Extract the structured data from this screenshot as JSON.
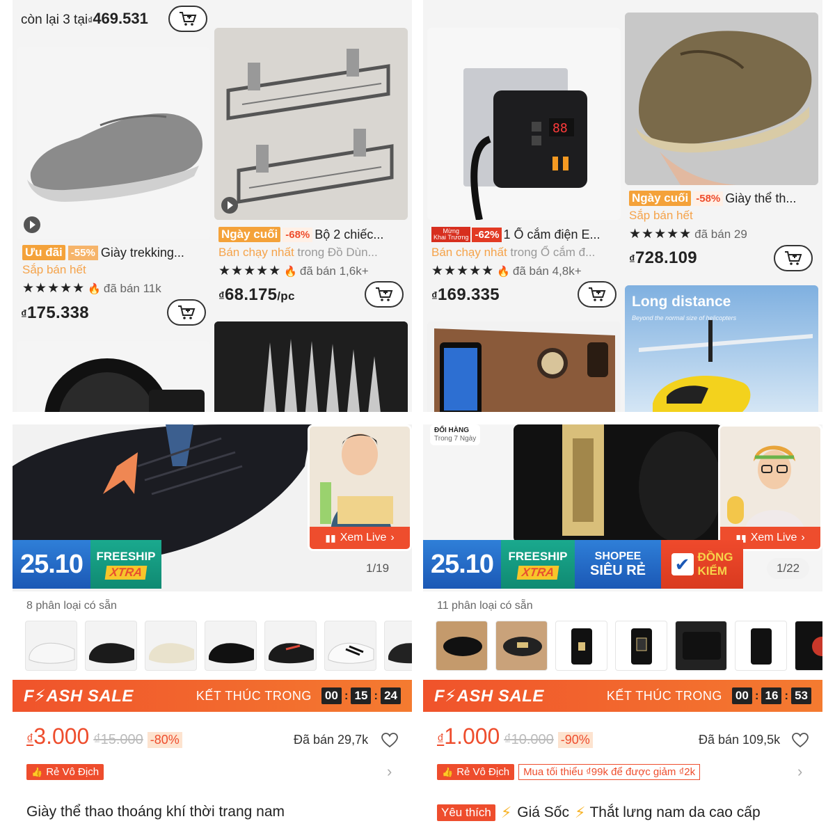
{
  "left_grid": {
    "stock_line": {
      "text": "còn lại 3 tại",
      "cur": "₫",
      "price": "469.531"
    },
    "p1": {
      "tag": "Ưu đãi",
      "pct": "-55%",
      "name": "Giày trekking...",
      "sub": "Sắp bán hết",
      "stars": "★★★★★",
      "sold": "đã bán 11k",
      "cur": "₫",
      "price": "175.338"
    },
    "p2": {
      "tag": "Ngày cuối",
      "pct": "-68%",
      "name": "Bộ 2 chiếc...",
      "best_hl": "Bán chạy nhất",
      "best_rest": " trong Đồ Dùn...",
      "stars": "★★★★★",
      "sold": "đã bán 1,6k+",
      "cur": "₫",
      "price": "68.175",
      "unit": "/pc"
    }
  },
  "right_grid": {
    "p3": {
      "tag_top": "Mừng",
      "tag_bottom": "Khai Trương",
      "pct": "-62%",
      "name": "1 Ổ cắm điện E...",
      "best_hl": "Bán chạy nhất",
      "best_rest": " trong Ổ cắm đ...",
      "stars": "★★★★★",
      "sold": "đã bán 4,8k+",
      "cur": "₫",
      "price": "169.335"
    },
    "p4": {
      "tag": "Ngày cuối",
      "pct": "-58%",
      "name": "Giày thể th...",
      "sub": "Sắp bán hết",
      "stars": "★★★★★",
      "sold": "đã bán 29",
      "cur": "₫",
      "price": "728.109"
    },
    "heli": {
      "title": "Long distance",
      "subtitle": "Beyond the normal size of helicopters"
    }
  },
  "left_detail": {
    "banner_date": "25.10",
    "free1": "FREESHIP",
    "free2": "XTRA",
    "live": "Xem Live",
    "pager": "1/19",
    "variants": "8 phân loại có sẵn",
    "flash_title": "F⚡ASH SALE",
    "ends": "KẾT THÚC TRONG",
    "timer": [
      "00",
      "15",
      "24"
    ],
    "cur": "₫",
    "price": "3.000",
    "orig": "₫15.000",
    "disc": "-80%",
    "sold": "Đã bán 29,7k",
    "voucher": "Rẻ Vô Địch",
    "name": "Giày thể thao thoáng khí thời trang nam"
  },
  "right_detail": {
    "return_badge1": "ĐỔI HÀNG",
    "return_badge2": "Trong 7 Ngày",
    "banner_date": "25.10",
    "free1": "FREESHIP",
    "free2": "XTRA",
    "shopee1": "SHOPEE",
    "shopee2": "SIÊU RẺ",
    "dong1": "ĐỒNG",
    "dong2": "KIỂM",
    "live": "Xem Live",
    "pager": "1/22",
    "variants": "11 phân loại có sẵn",
    "flash_title": "F⚡ASH SALE",
    "ends": "KẾT THÚC TRONG",
    "timer": [
      "00",
      "16",
      "53"
    ],
    "cur": "₫",
    "price": "1.000",
    "orig": "₫10.000",
    "disc": "-90%",
    "sold": "Đã bán 109,5k",
    "voucher": "Rẻ Vô Địch",
    "voucher_min": "Mua tối thiểu ₫99k để được giảm ₫2k",
    "yeu_thich": "Yêu thích",
    "gia_soc": "Giá Sốc",
    "name": "Thắt lưng nam da cao cấp"
  },
  "colors": {
    "shopee_orange": "#ee4d2d",
    "tag_orange": "#f4a23a",
    "banner_blue": "#1b58b5",
    "freeship_teal": "#108a72"
  }
}
